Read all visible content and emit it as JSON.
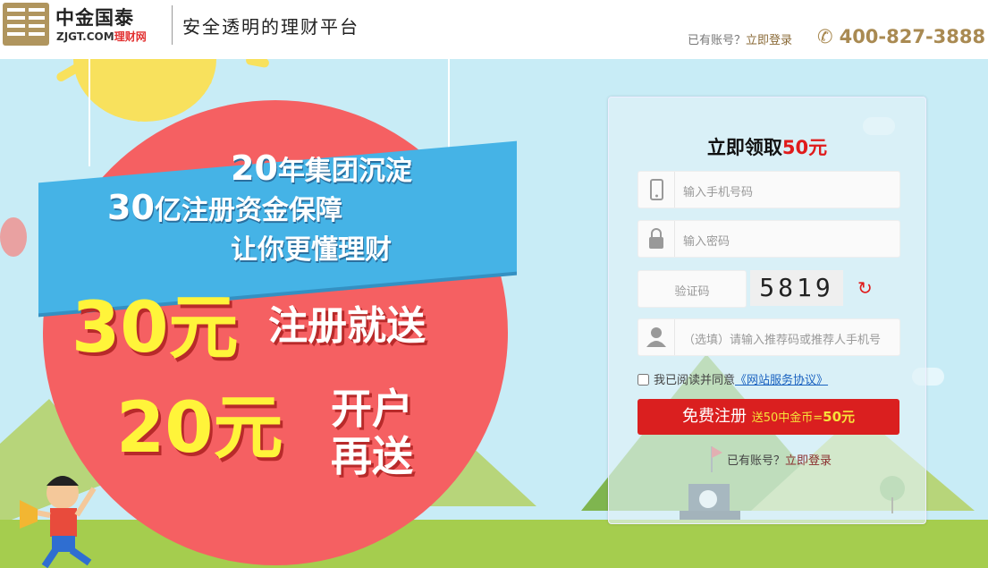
{
  "header": {
    "logo_cn": "中金国泰",
    "logo_en_prefix": "ZJGT.COM",
    "logo_en_suffix": "理财网",
    "slogan": "安全透明的理财平台",
    "login_prompt": "已有账号？",
    "login_link": "立即登录",
    "phone": "400-827-3888"
  },
  "banner": {
    "line1_num": "20",
    "line1_text": "年集团沉淀",
    "line2_num": "30",
    "line2_text": "亿注册资金保障",
    "line3": "让你更懂理财",
    "promo1_amount": "30元",
    "promo1_text": "注册就送",
    "promo2_amount": "20元",
    "promo2_line1": "开户",
    "promo2_line2": "再送"
  },
  "form": {
    "title_prefix": "立即领取",
    "title_amount": "50元",
    "phone_placeholder": "输入手机号码",
    "password_placeholder": "输入密码",
    "captcha_placeholder": "验证码",
    "captcha_code": "5819",
    "referrer_placeholder": "（选填）请输入推荐码或推荐人手机号",
    "agree_text": "我已阅读并同意",
    "agree_link": "《网站服务协议》",
    "register_label": "免费注册",
    "register_sub": "送50中金币=",
    "register_sub_amount": "50元",
    "login_prompt": "已有账号？",
    "login_link": "立即登录"
  },
  "colors": {
    "brand_gold": "#a98a52",
    "accent_red": "#da1f1f",
    "banner_sky": "#c8ecf6",
    "ribbon_blue": "#45b3e6"
  },
  "icons": [
    "phone-icon",
    "mobile-icon",
    "lock-icon",
    "user-icon",
    "refresh-icon"
  ]
}
